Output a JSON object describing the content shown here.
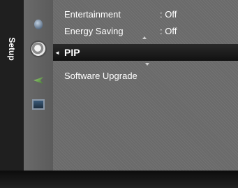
{
  "side_tab": {
    "label": "Setup"
  },
  "icons": {
    "picture": "picture-icon",
    "setup": "setup-gear-icon",
    "input": "input-icon",
    "support": "support-icon"
  },
  "menu": {
    "items": [
      {
        "label": "Entertainment",
        "value": ": Off"
      },
      {
        "label": "Energy Saving",
        "value": ": Off"
      },
      {
        "label": "PIP",
        "selected": true
      },
      {
        "label": "Software Upgrade"
      }
    ]
  },
  "colors": {
    "background": "#6a6a6a",
    "highlight": "#111111",
    "text": "#ffffff"
  }
}
